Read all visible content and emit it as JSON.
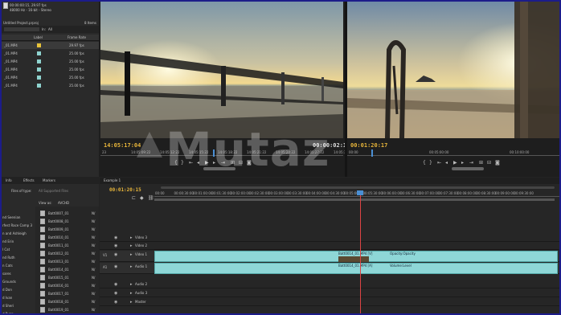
{
  "project_panel": {
    "info_line1": "00:00:00:15, 29.97 fps",
    "info_line2": "48000 Hz - 16-bit - Stereo",
    "title": "Untitled Project.prproj",
    "items_count": "8 Items",
    "in_label": "In:",
    "in_value": "All",
    "col_label": "Label",
    "col_frame_rate": "Frame Rate",
    "rows": [
      {
        "name": "_01.MP4",
        "label_color": "#e8c33a",
        "fps": "29.97 fps"
      },
      {
        "name": "_01.MP4",
        "label_color": "#8fd3cf",
        "fps": "25.00 fps"
      },
      {
        "name": "_01.MP4",
        "label_color": "#8fd3cf",
        "fps": "25.00 fps"
      },
      {
        "name": "_01.MP4",
        "label_color": "#8fd3cf",
        "fps": "25.00 fps"
      },
      {
        "name": "_01.MP4",
        "label_color": "#8fd3cf",
        "fps": "25.00 fps"
      },
      {
        "name": "_01.MP4",
        "label_color": "#8fd3cf",
        "fps": "25.00 fps"
      }
    ]
  },
  "source_monitor": {
    "timecode_in": "14:05:17:04",
    "timecode_dur": "00:00:02:19",
    "ruler_labels": [
      "23",
      "14:05:09:22",
      "14:05:12:22",
      "14:05:15:22",
      "14:05:18:22",
      "14:05:21:22",
      "14:05:24:22",
      "14:05:27:22",
      "14:05:30:22"
    ]
  },
  "program_monitor": {
    "timecode_pos": "00:01:20:17",
    "ruler_labels": [
      "00:00",
      "00:05:00:00",
      "00:10:00:00"
    ]
  },
  "media_browser": {
    "tabs": [
      "Info",
      "Effects",
      "Markers"
    ],
    "path_label": "Files of type:",
    "path_value": "All Supported Files",
    "view_as_label": "View as:",
    "view_as_value": "AVCHD",
    "folders": [
      "nd Seenian",
      "rfest Race Camp 3",
      "n and Ashleigh",
      "nd Erin",
      "l Cat",
      "nd Ruth",
      "n Cats",
      "sares",
      "Grounds",
      "d Don",
      "d Ivan",
      "d Sheri",
      "d Ryan"
    ],
    "files": [
      "Batt0007_01",
      "Batt0008_01",
      "Batt0009_01",
      "Batt0010_01",
      "Batt0011_01",
      "Batt0012_01",
      "Batt0013_01",
      "Batt0014_01",
      "Batt0015_01",
      "Batt0016_01",
      "Batt0017_01",
      "Batt0018_01",
      "Batt0019_01"
    ],
    "file_col": "N/"
  },
  "timeline": {
    "tab": "Example 1",
    "timecode": "00:01:20:15",
    "ruler_labels": [
      "00:00",
      "00:00:30:00",
      "00:01:00:00",
      "00:01:30:00",
      "00:02:00:00",
      "00:02:30:00",
      "00:03:00:00",
      "00:03:30:00",
      "00:04:00:00",
      "00:04:30:00",
      "00:05:00:00",
      "00:05:30:00",
      "00:06:00:00",
      "00:06:30:00",
      "00:07:00:00",
      "00:07:30:00",
      "00:08:00:00",
      "00:08:30:00",
      "00:09:00:00",
      "00:09:30:00"
    ],
    "tracks": [
      {
        "name": "Video 3"
      },
      {
        "name": "Video 2"
      },
      {
        "name": "Video 1"
      },
      {
        "name": "Audio 1"
      },
      {
        "name": "Audio 2"
      },
      {
        "name": "Audio 3"
      },
      {
        "name": "Master"
      }
    ],
    "v1_clip_label": "Batt0014_01.MP4 [V]",
    "v1_clip_effect": "Opacity:Opacity",
    "a1_clip_label": "Batt0014_01.MP4 [A]",
    "a1_clip_effect": "Volume:Level",
    "side_labels": [
      "V1",
      "A1"
    ]
  },
  "watermark": "Mutaz"
}
